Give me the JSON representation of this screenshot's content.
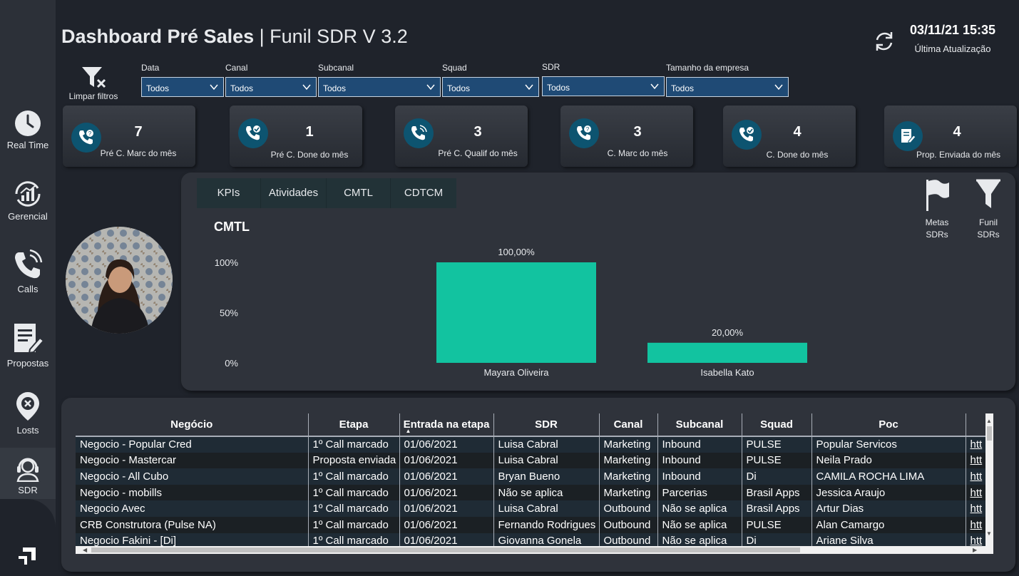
{
  "header": {
    "title_bold": "Dashboard Pré Sales",
    "separator": " | ",
    "title_sub": "Funil SDR V 3.2",
    "last_update_datetime": "03/11/21 15:35",
    "last_update_label": "Última Atualização"
  },
  "sidebar": {
    "items": [
      {
        "label": "Real Time",
        "icon": "clock-icon"
      },
      {
        "label": "Gerencial",
        "icon": "growth-chart-icon"
      },
      {
        "label": "Calls",
        "icon": "phone-icon"
      },
      {
        "label": "Propostas",
        "icon": "document-edit-icon"
      },
      {
        "label": "Losts",
        "icon": "lost-pin-icon"
      },
      {
        "label": "SDR",
        "icon": "headset-user-icon"
      }
    ],
    "active": "SDR"
  },
  "filters": {
    "clear_label": "Limpar filtros",
    "items": [
      {
        "label": "Data",
        "value": "Todos"
      },
      {
        "label": "Canal",
        "value": "Todos"
      },
      {
        "label": "Subcanal",
        "value": "Todos"
      },
      {
        "label": "Squad",
        "value": "Todos"
      },
      {
        "label": "SDR",
        "value": "Todos"
      },
      {
        "label": "Tamanho da empresa",
        "value": "Todos"
      }
    ]
  },
  "kpis": [
    {
      "value": "7",
      "label": "Pré C. Marc do mês",
      "icon": "phone-question-icon"
    },
    {
      "value": "1",
      "label": "Pré C. Done do mês",
      "icon": "phone-check-icon"
    },
    {
      "value": "3",
      "label": "Pré C. Qualif do mês",
      "icon": "phone-ringing-icon"
    },
    {
      "value": "3",
      "label": "C. Marc do mês",
      "icon": "phone-question-icon"
    },
    {
      "value": "4",
      "label": "C. Done do mês",
      "icon": "phone-check-icon"
    },
    {
      "value": "4",
      "label": "Prop. Enviada do mês",
      "icon": "document-edit-icon"
    }
  ],
  "tabs": [
    "KPIs",
    "Atividades",
    "CMTL",
    "CDTCM"
  ],
  "side_buttons": [
    {
      "line1": "Metas",
      "line2": "SDRs",
      "icon": "flag-icon"
    },
    {
      "line1": "Funil",
      "line2": "SDRs",
      "icon": "funnel-icon"
    }
  ],
  "chart_data": {
    "type": "bar",
    "title": "CMTL",
    "categories": [
      "Mayara Oliveira",
      "Isabella Kato"
    ],
    "values": [
      100,
      20
    ],
    "data_labels": [
      "100,00%",
      "20,00%"
    ],
    "yticks": [
      "0%",
      "50%",
      "100%"
    ],
    "ylim": [
      0,
      100
    ],
    "bar_color": "#12c3a0",
    "xlabel": "",
    "ylabel": ""
  },
  "table": {
    "columns": [
      "Negócio",
      "Etapa",
      "Entrada na etapa",
      "SDR",
      "Canal",
      "Subcanal",
      "Squad",
      "Poc",
      ""
    ],
    "rows": [
      [
        "Negocio - Popular Cred",
        "1º Call marcado",
        "01/06/2021",
        "Luisa Cabral",
        "Marketing",
        "Inbound",
        "PULSE",
        "Popular Servicos",
        "htt"
      ],
      [
        "Negocio - Mastercar",
        "Proposta enviada",
        "01/06/2021",
        "Luisa Cabral",
        "Marketing",
        "Inbound",
        "PULSE",
        "Neila Prado",
        "htt"
      ],
      [
        "Negocio - All Cubo",
        "1º Call marcado",
        "01/06/2021",
        "Bryan Bueno",
        "Marketing",
        "Inbound",
        "Di",
        "CAMILA ROCHA LIMA",
        "htt"
      ],
      [
        "Negocio - mobills",
        "1º Call marcado",
        "01/06/2021",
        "Não se aplica",
        "Marketing",
        "Parcerias",
        "Brasil Apps",
        "Jessica Araujo",
        "htt"
      ],
      [
        "Negocio Avec",
        "1º Call marcado",
        "01/06/2021",
        "Luisa Cabral",
        "Outbound",
        "Não se aplica",
        "Brasil Apps",
        "Artur Dias",
        "htt"
      ],
      [
        "CRB Construtora (Pulse NA)",
        "1º Call marcado",
        "01/06/2021",
        "Fernando Rodrigues",
        "Outbound",
        "Não se aplica",
        "PULSE",
        "Alan Camargo",
        "htt"
      ],
      [
        "Negocio Fakini - [Di]",
        "1º Call marcado",
        "01/06/2021",
        "Giovanna Gonela",
        "Outbound",
        "Não se aplica",
        "Di",
        "Ariane Silva",
        "htt"
      ]
    ]
  }
}
